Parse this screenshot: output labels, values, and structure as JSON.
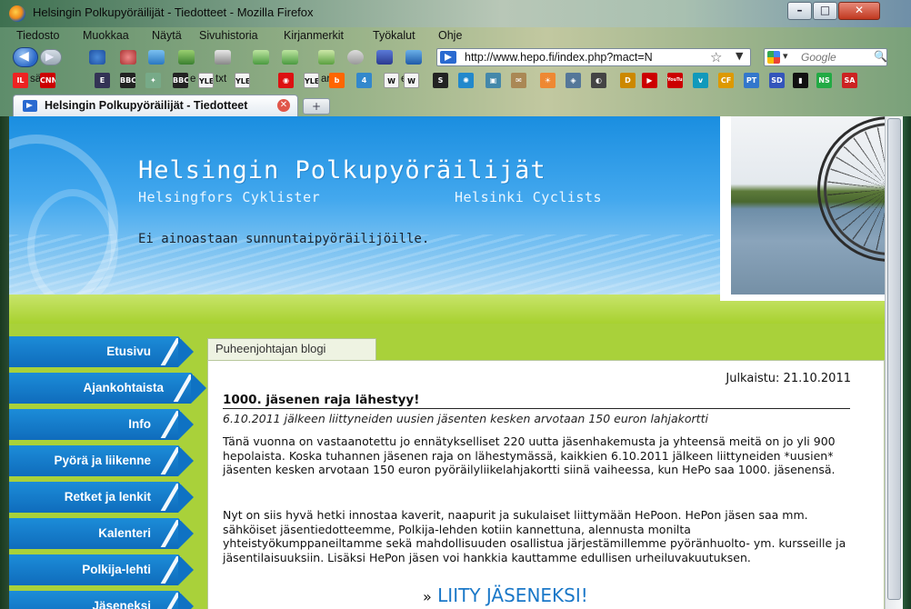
{
  "window": {
    "title": "Helsingin Polkupyöräilijät - Tiedotteet - Mozilla Firefox",
    "controls": {
      "minimize": "–",
      "maximize": "□",
      "close": "✕"
    }
  },
  "menu": [
    "Tiedosto",
    "Muokkaa",
    "Näytä",
    "Sivuhistoria",
    "Kirjanmerkit",
    "Työkalut",
    "Ohje"
  ],
  "toolbar": {
    "url": "http://www.hepo.fi/index.php?mact=N",
    "search_placeholder": "Google"
  },
  "bookmarks": [
    {
      "icon_text": "IL",
      "label": "sää",
      "color": "#e22"
    },
    {
      "icon_text": "CNN",
      "label": "",
      "color": "#c00"
    },
    {
      "icon_text": "E",
      "label": "",
      "color": "#335"
    },
    {
      "icon_text": "BBC",
      "label": "",
      "color": "#222"
    },
    {
      "icon_text": "✦",
      "label": "",
      "color": "#7a8"
    },
    {
      "icon_text": "BBC",
      "label": "e",
      "color": "#222"
    },
    {
      "icon_text": "YLE",
      "label": "txt",
      "color": "#fff"
    },
    {
      "icon_text": "YLE",
      "label": "",
      "color": "#fff"
    },
    {
      "icon_text": "◉",
      "label": "",
      "color": "#d11"
    },
    {
      "icon_text": "YLE",
      "label": "are",
      "color": "#fff"
    },
    {
      "icon_text": "b",
      "label": "",
      "color": "#f60"
    },
    {
      "icon_text": "4",
      "label": "",
      "color": "#38c"
    },
    {
      "icon_text": "W",
      "label": "e",
      "color": "#fff"
    },
    {
      "icon_text": "W",
      "label": "",
      "color": "#fff"
    },
    {
      "icon_text": "S",
      "label": "",
      "color": "#222"
    },
    {
      "icon_text": "✺",
      "label": "",
      "color": "#28c"
    },
    {
      "icon_text": "▣",
      "label": "",
      "color": "#48a"
    },
    {
      "icon_text": "✉",
      "label": "",
      "color": "#a85"
    },
    {
      "icon_text": "☀",
      "label": "",
      "color": "#e83"
    },
    {
      "icon_text": "◈",
      "label": "",
      "color": "#579"
    },
    {
      "icon_text": "◐",
      "label": "",
      "color": "#444"
    },
    {
      "icon_text": "D",
      "label": "",
      "color": "#c80"
    },
    {
      "icon_text": "▶",
      "label": "",
      "color": "#c00"
    },
    {
      "icon_text": "YouTube",
      "label": "",
      "color": "#c00"
    },
    {
      "icon_text": "v",
      "label": "",
      "color": "#19b"
    },
    {
      "icon_text": "CF",
      "label": "",
      "color": "#d90"
    },
    {
      "icon_text": "PT",
      "label": "",
      "color": "#37c"
    },
    {
      "icon_text": "SD",
      "label": "",
      "color": "#35b"
    },
    {
      "icon_text": "▮",
      "label": "",
      "color": "#111"
    },
    {
      "icon_text": "NS",
      "label": "",
      "color": "#2a4"
    },
    {
      "icon_text": "SA",
      "label": "",
      "color": "#c22"
    }
  ],
  "tabs": {
    "active_label": "Helsingin Polkupyöräilijät - Tiedotteet",
    "new_tab": "+"
  },
  "site": {
    "title": "Helsingin Polkupyöräilijät",
    "subtitle_sv": "Helsingfors Cyklister",
    "subtitle_en": "Helsinki Cyclists",
    "slogan": "Ei ainoastaan sunnuntaipyöräilijöille."
  },
  "nav": [
    "Etusivu",
    "Ajankohtaista",
    "Info",
    "Pyörä ja liikenne",
    "Retket ja lenkit",
    "Kalenteri",
    "Polkija-lehti",
    "Jäseneksi"
  ],
  "blog": {
    "tab_label": "Puheenjohtajan blogi",
    "published": "Julkaistu: 21.10.2011",
    "title": "1000. jäsenen raja lähestyy!",
    "lead": "6.10.2011 jälkeen liittyneiden uusien jäsenten kesken arvotaan 150 euron lahjakortti",
    "paragraphs": [
      "Tänä vuonna on vastaanotettu jo ennätykselliset 220 uutta jäsenhakemusta ja yhteensä meitä on jo yli 900 hepolaista. Koska tuhannen jäsenen raja on lähestymässä, kaikkien 6.10.2011 jälkeen liittyneiden *uusien* jäsenten kesken arvotaan 150 euron pyöräilyliikelahjakortti siinä vaiheessa, kun HePo saa 1000. jäsenensä.",
      "Nyt on siis hyvä hetki innostaa kaverit, naapurit ja sukulaiset liittymään HePoon. HePon jäsen saa mm. sähköiset jäsentiedotteemme, Polkija-lehden kotiin kannettuna, alennusta monilta yhteistyökumppaneiltamme sekä mahdollisuuden osallistua järjestämillemme pyöränhuolto- ym. kursseille ja jäsentilaisuuksiin. Lisäksi HePon jäsen voi hankkia kauttamme edullisen urheiluvakuutuksen."
    ],
    "join_arrow": "»",
    "join_label": "LIITY JÄSENEKSI!"
  }
}
